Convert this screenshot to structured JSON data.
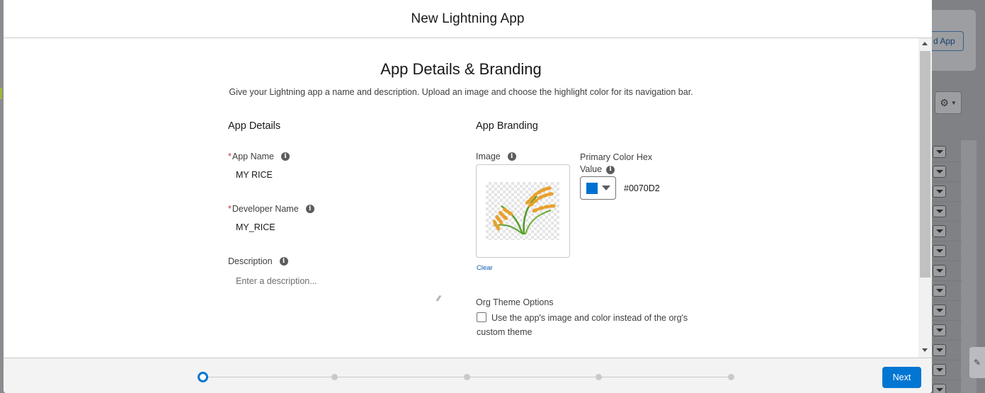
{
  "modal": {
    "title": "New Lightning App",
    "step_title": "App Details & Branding",
    "step_subtitle": "Give your Lightning app a name and description. Upload an image and choose the highlight color for its navigation bar."
  },
  "app_details": {
    "heading": "App Details",
    "app_name": {
      "label": "App Name",
      "required": true,
      "value": "MY RICE"
    },
    "developer_name": {
      "label": "Developer Name",
      "required": true,
      "value": "MY_RICE"
    },
    "description": {
      "label": "Description",
      "placeholder": "Enter a description..."
    }
  },
  "app_branding": {
    "heading": "App Branding",
    "image_label": "Image",
    "clear_label": "Clear",
    "primary_color_label_line1": "Primary Color Hex",
    "primary_color_label_line2": "Value",
    "primary_color_value": "#0070D2",
    "swatch_color": "#0070D2"
  },
  "org_theme": {
    "heading": "Org Theme Options",
    "checkbox_label": "Use the app's image and color instead of the org's custom theme",
    "checked": false
  },
  "footer": {
    "next_label": "Next",
    "steps_total": 5,
    "current_step": 1
  },
  "background": {
    "new_app_label": "d App"
  },
  "colors": {
    "brand_blue": "#0176d3",
    "required_red": "#c23934"
  }
}
